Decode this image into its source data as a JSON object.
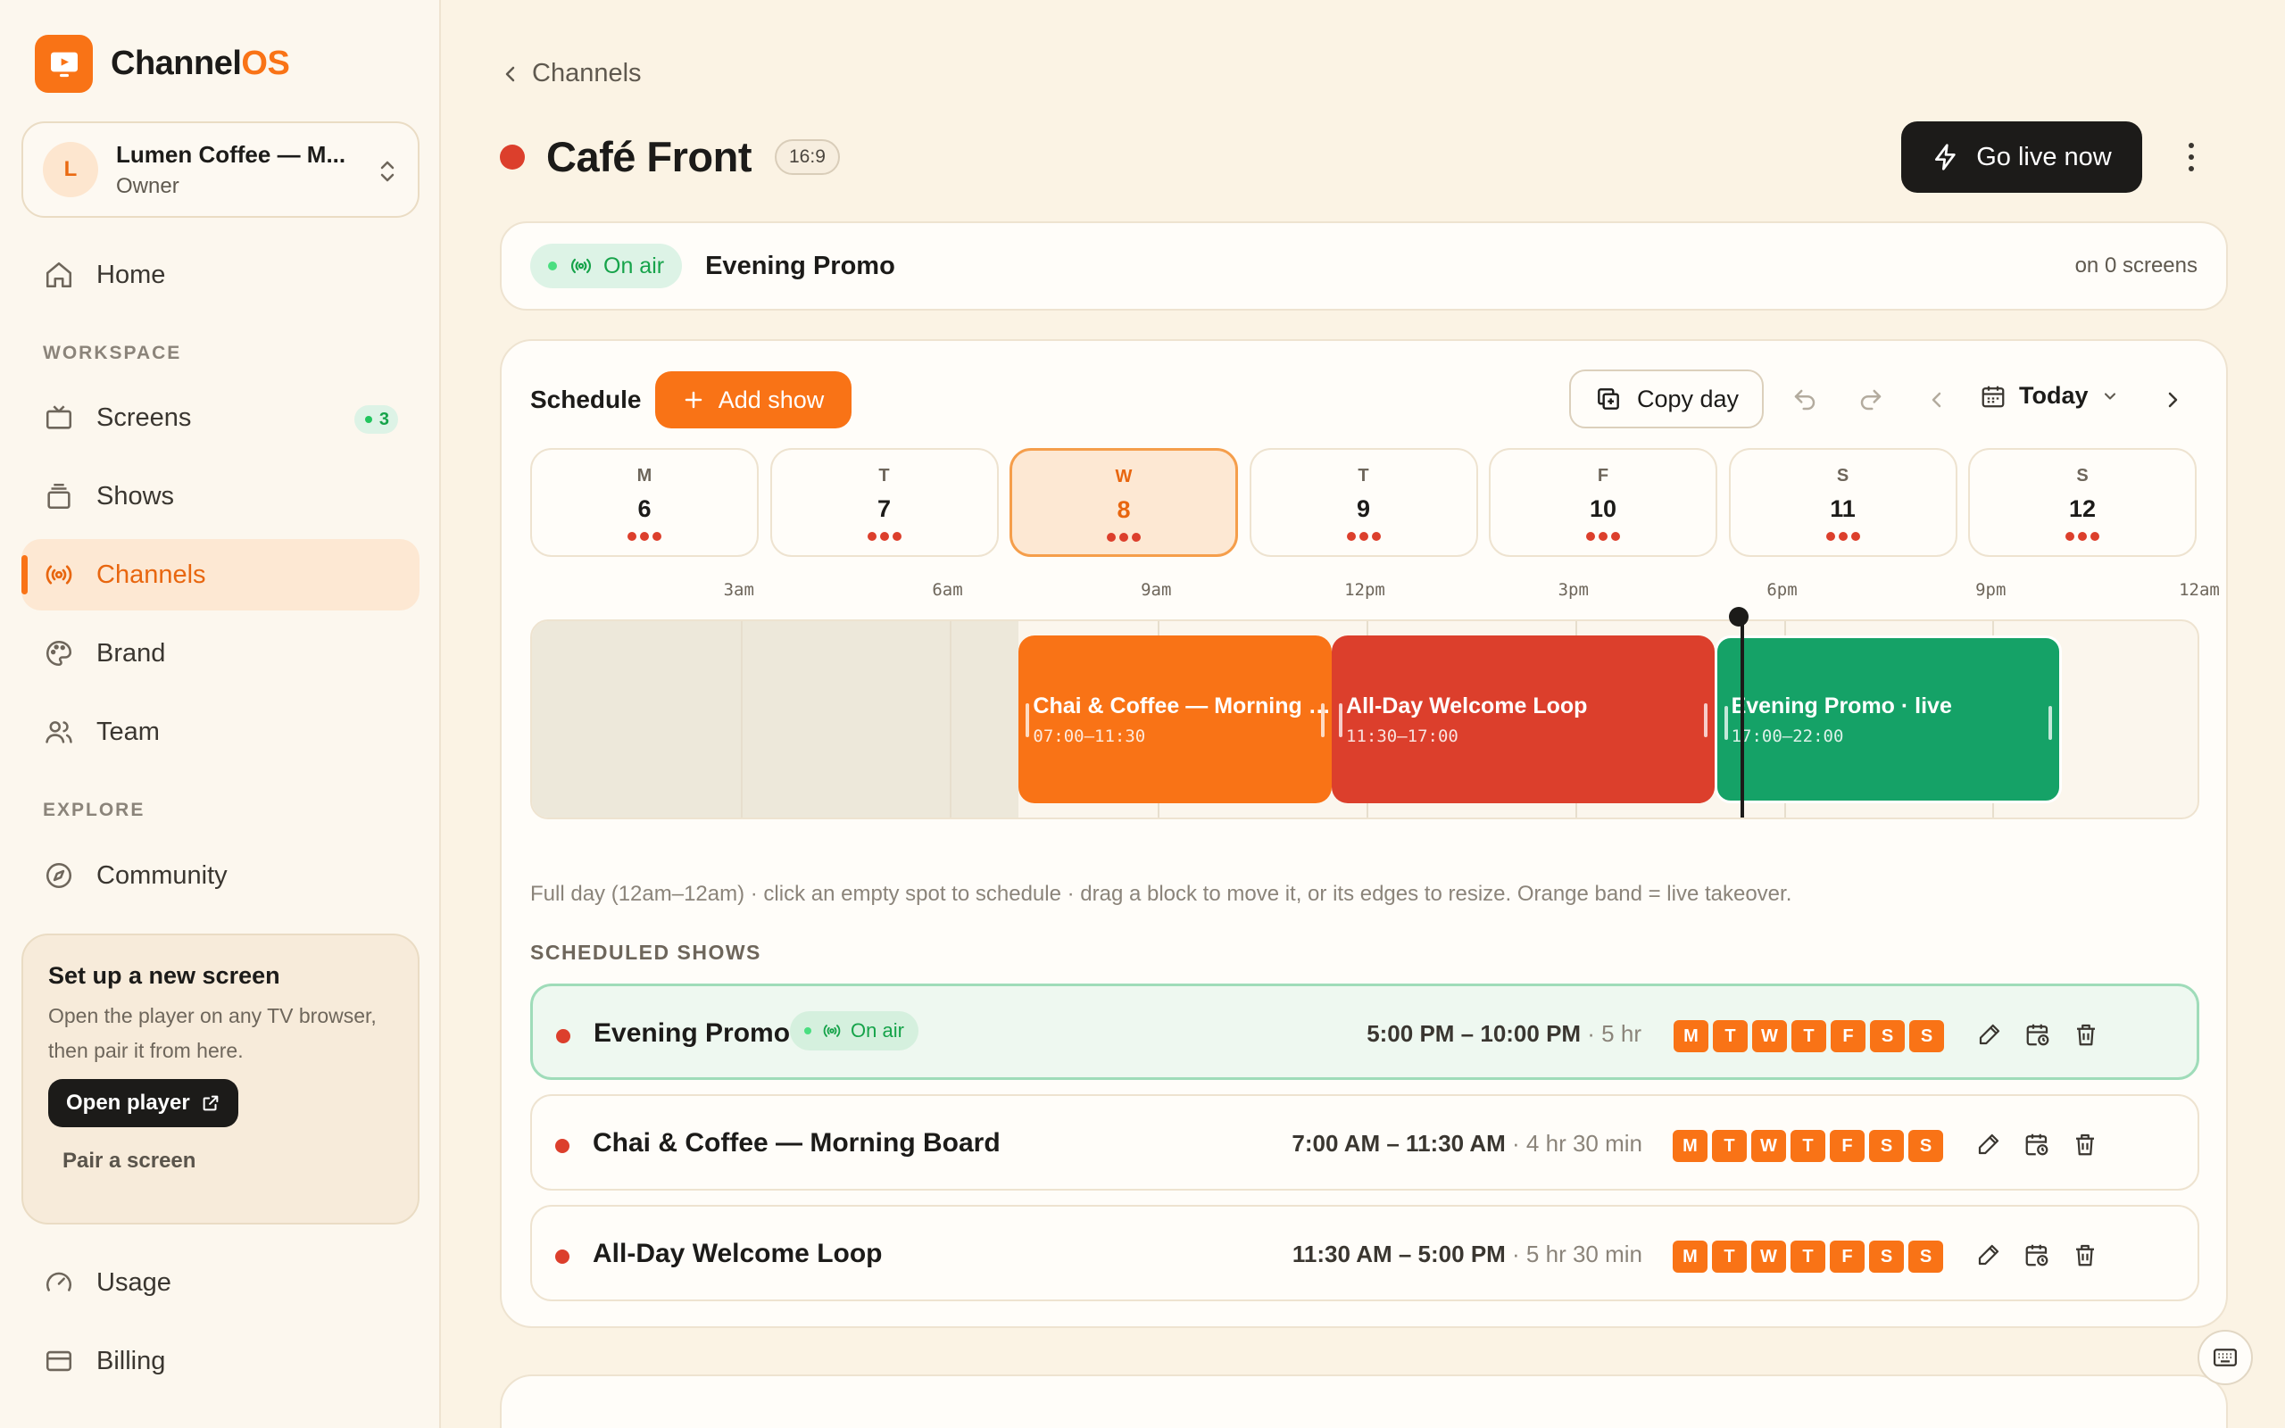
{
  "app": {
    "name_main": "Channel",
    "name_accent": "OS",
    "brand_color": "#F97316"
  },
  "org": {
    "initial": "L",
    "name": "Lumen Coffee — M...",
    "role": "Owner"
  },
  "nav": {
    "home": "Home",
    "workspace_label": "WORKSPACE",
    "screens": "Screens",
    "screens_badge": "3",
    "shows": "Shows",
    "channels": "Channels",
    "brand": "Brand",
    "team": "Team",
    "explore_label": "EXPLORE",
    "community": "Community",
    "usage": "Usage",
    "billing": "Billing"
  },
  "setup": {
    "title": "Set up a new screen",
    "desc": "Open the player on any TV browser, then pair it from here.",
    "open_player": "Open player",
    "pair": "Pair a screen"
  },
  "header": {
    "back": "Channels",
    "title": "Café Front",
    "aspect": "16:9",
    "go_live": "Go live now"
  },
  "onair": {
    "status": "On air",
    "show": "Evening Promo",
    "screens": "on 0 screens"
  },
  "schedule": {
    "title": "Schedule",
    "add_show": "Add show",
    "copy_day": "Copy day",
    "today": "Today",
    "days": [
      {
        "letter": "M",
        "num": "6",
        "active": false
      },
      {
        "letter": "T",
        "num": "7",
        "active": false
      },
      {
        "letter": "W",
        "num": "8",
        "active": true
      },
      {
        "letter": "T",
        "num": "9",
        "active": false
      },
      {
        "letter": "F",
        "num": "10",
        "active": false
      },
      {
        "letter": "S",
        "num": "11",
        "active": false
      },
      {
        "letter": "S",
        "num": "12",
        "active": false
      }
    ],
    "ticks": [
      "3am",
      "6am",
      "9am",
      "12pm",
      "3pm",
      "6pm",
      "9pm",
      "12am"
    ],
    "now_hour": 17.4,
    "blocks": [
      {
        "title": "Chai & Coffee — Morning B...",
        "time": "07:00–11:30",
        "start": 7,
        "end": 11.5,
        "color": "#F97316",
        "live": false
      },
      {
        "title": "All-Day Welcome Loop",
        "time": "11:30–17:00",
        "start": 11.5,
        "end": 17,
        "color": "#DC3F2C",
        "live": false
      },
      {
        "title": "Evening Promo · live",
        "time": "17:00–22:00",
        "start": 17,
        "end": 22,
        "color": "#15A267",
        "live": true
      }
    ],
    "hint": "Full day (12am–12am) · click an empty spot to schedule · drag a block to move it, or its edges to resize. Orange band = live takeover.",
    "list_label": "SCHEDULED SHOWS",
    "rows": [
      {
        "name": "Evening Promo",
        "status": "On air",
        "time": "5:00 PM – 10:00 PM",
        "duration": "· 5 hr"
      },
      {
        "name": "Chai & Coffee — Morning Board",
        "status": "",
        "time": "7:00 AM – 11:30 AM",
        "duration": "· 4 hr 30 min"
      },
      {
        "name": "All-Day Welcome Loop",
        "status": "",
        "time": "11:30 AM – 5:00 PM",
        "duration": "· 5 hr 30 min"
      }
    ],
    "weekday_letters": [
      "M",
      "T",
      "W",
      "T",
      "F",
      "S",
      "S"
    ]
  }
}
